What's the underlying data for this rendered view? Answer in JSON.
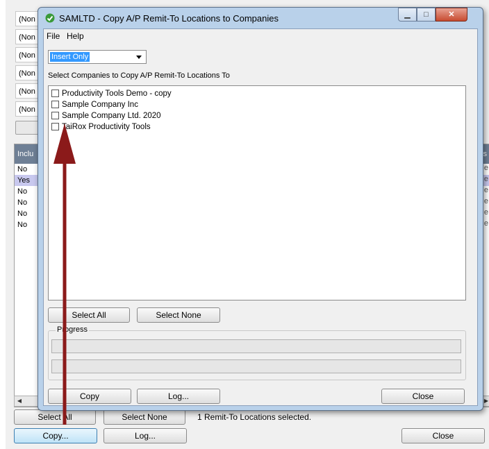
{
  "background_window": {
    "rows": [
      "(Non",
      "(Non",
      "(Non",
      "(Non",
      "(Non",
      "(Non"
    ],
    "grid_header_left": "Inclu",
    "grid_header_right": "s",
    "grid_values": [
      "No",
      "Yes",
      "No",
      "No",
      "No",
      "No"
    ],
    "selected_row_index": 1,
    "buttons": {
      "select_all": "Select All",
      "select_none": "Select None",
      "copy": "Copy...",
      "log": "Log...",
      "close": "Close"
    },
    "status_text": "1 Remit-To Locations selected."
  },
  "dialog": {
    "title": "SAMLTD - Copy A/P Remit-To Locations to Companies",
    "menu": [
      "File",
      "Help"
    ],
    "mode_value": "Insert Only",
    "list_label": "Select Companies to Copy A/P Remit-To Locations To",
    "companies": [
      {
        "label": "Productivity Tools Demo - copy",
        "checked": false
      },
      {
        "label": "Sample Company Inc",
        "checked": false
      },
      {
        "label": "Sample Company Ltd. 2020",
        "checked": false
      },
      {
        "label": "TaiRox Productivity Tools",
        "checked": false
      }
    ],
    "buttons": {
      "select_all": "Select All",
      "select_none": "Select None",
      "copy": "Copy",
      "log": "Log...",
      "close": "Close"
    },
    "progress_label": "Progress"
  },
  "colors": {
    "annotation_arrow": "#8b1a1a",
    "dialog_frame": "#b9d1ea",
    "selection": "#3399ff"
  }
}
